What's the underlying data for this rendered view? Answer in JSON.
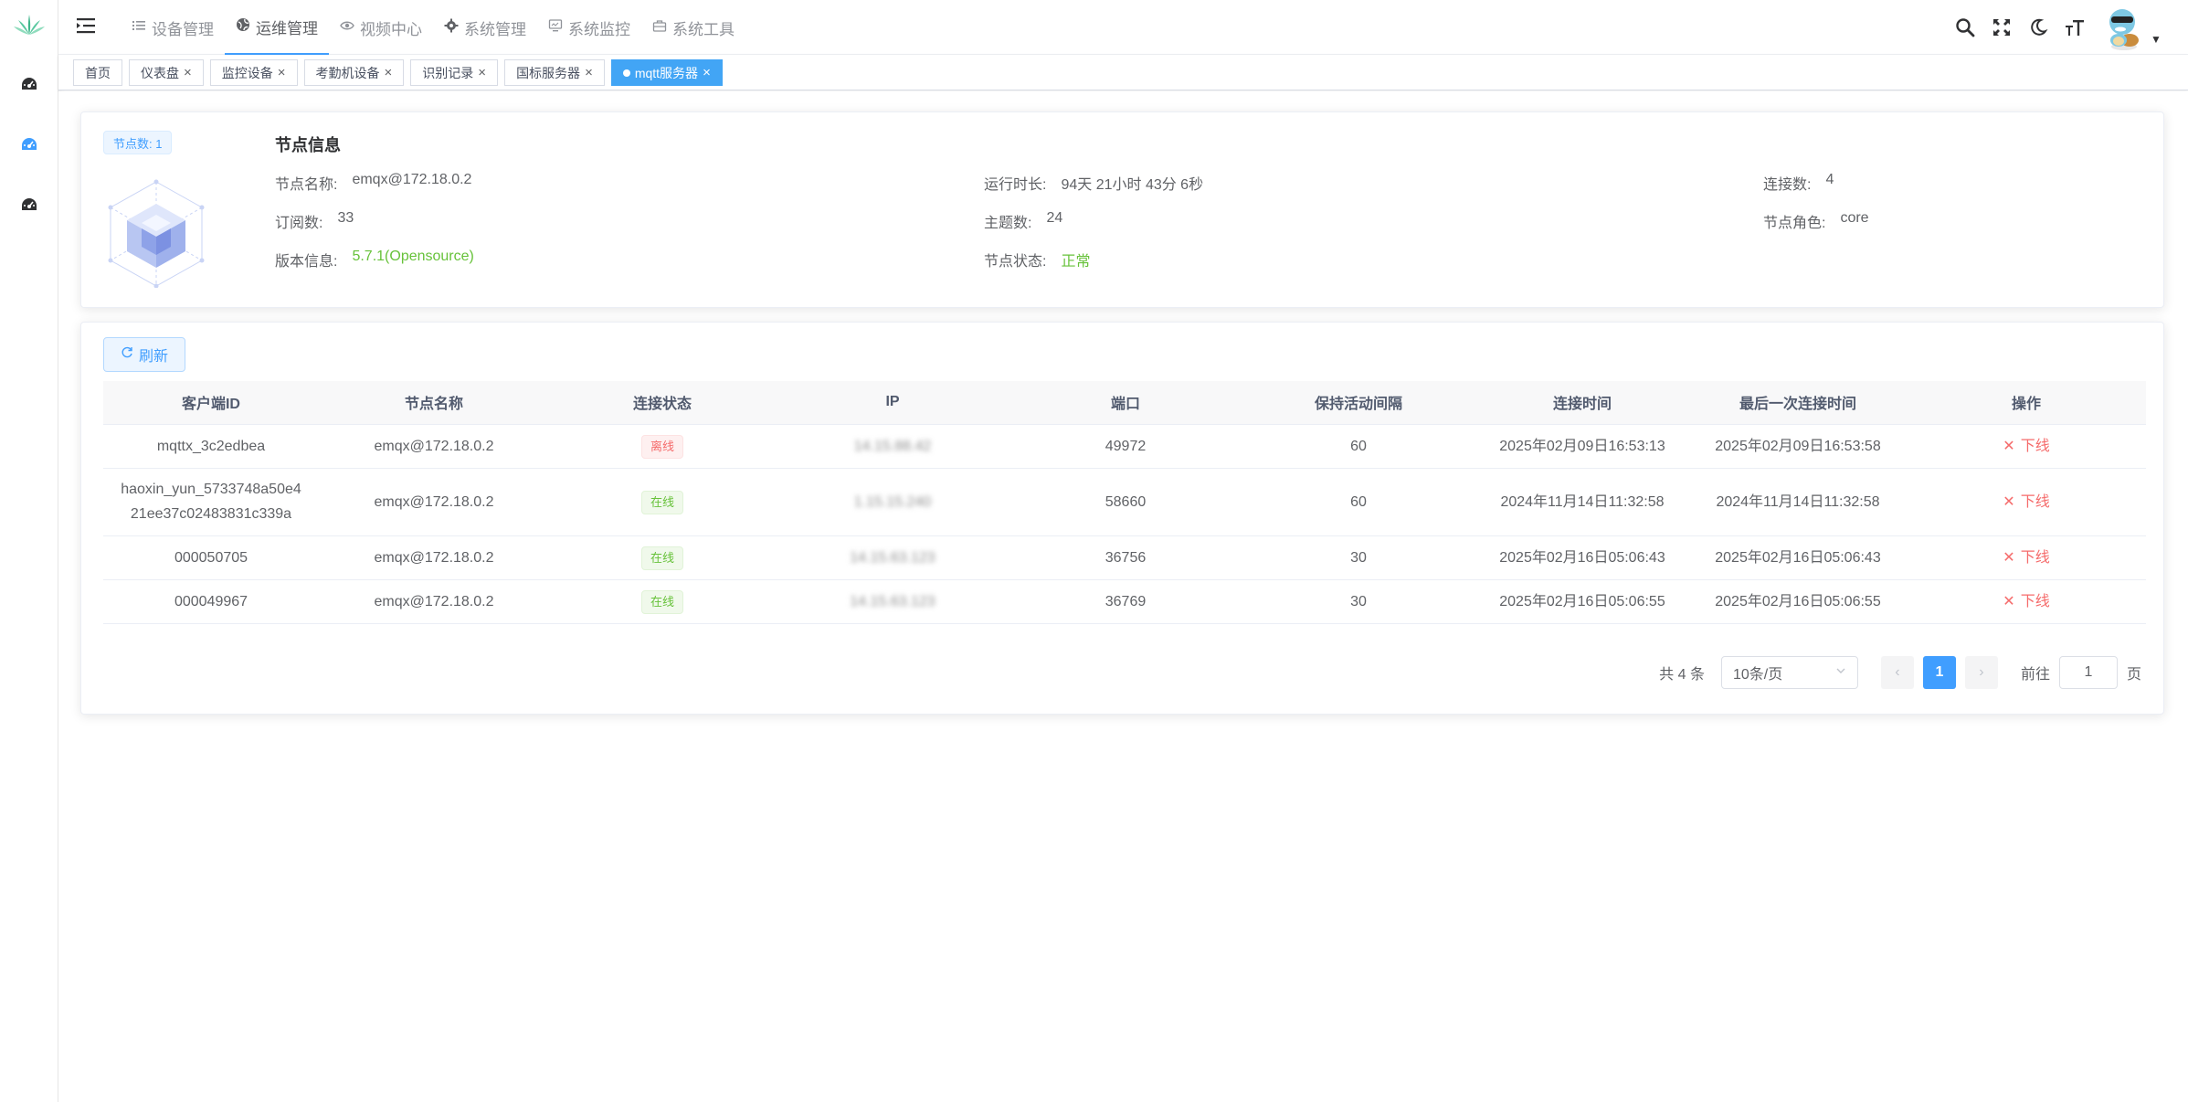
{
  "sidebar": {
    "logo": "lotus-logo",
    "items": [
      {
        "icon": "dashboard-icon"
      },
      {
        "icon": "dashboard-icon",
        "active": true
      },
      {
        "icon": "dashboard-icon"
      }
    ]
  },
  "navbar": {
    "menu": [
      {
        "label": "设备管理",
        "icon": "list-icon"
      },
      {
        "label": "运维管理",
        "icon": "globe-icon",
        "active": true
      },
      {
        "label": "视频中心",
        "icon": "eye-icon"
      },
      {
        "label": "系统管理",
        "icon": "gear-icon"
      },
      {
        "label": "系统监控",
        "icon": "monitor-icon"
      },
      {
        "label": "系统工具",
        "icon": "toolbox-icon"
      }
    ]
  },
  "tags": [
    {
      "label": "首页",
      "closable": false
    },
    {
      "label": "仪表盘",
      "closable": true
    },
    {
      "label": "监控设备",
      "closable": true
    },
    {
      "label": "考勤机设备",
      "closable": true
    },
    {
      "label": "识别记录",
      "closable": true
    },
    {
      "label": "国标服务器",
      "closable": true
    },
    {
      "label": "mqtt服务器",
      "closable": true,
      "active": true
    }
  ],
  "node_info": {
    "badge": "节点数: 1",
    "title": "节点信息",
    "name_label": "节点名称:",
    "name_value": "emqx@172.18.0.2",
    "uptime_label": "运行时长:",
    "uptime_value": "94天 21小时 43分 6秒",
    "conn_label": "连接数:",
    "conn_value": "4",
    "sub_label": "订阅数:",
    "sub_value": "33",
    "topic_label": "主题数:",
    "topic_value": "24",
    "role_label": "节点角色:",
    "role_value": "core",
    "version_label": "版本信息:",
    "version_value": "5.7.1(Opensource)",
    "status_label": "节点状态:",
    "status_value": "正常"
  },
  "table": {
    "refresh_label": "刷新",
    "headers": [
      "客户端ID",
      "节点名称",
      "连接状态",
      "IP",
      "端口",
      "保持活动间隔",
      "连接时间",
      "最后一次连接时间",
      "操作"
    ],
    "rows": [
      {
        "client_id": "mqttx_3c2edbea",
        "node": "emqx@172.18.0.2",
        "status": "离线",
        "status_type": "offline",
        "ip": "14.15.88.42",
        "port": "49972",
        "keepalive": "60",
        "connected_at": "2025年02月09日16:53:13",
        "last_connected_at": "2025年02月09日16:53:58",
        "action": "下线"
      },
      {
        "client_id": "haoxin_yun_5733748a50e4 21ee37c02483831c339a",
        "node": "emqx@172.18.0.2",
        "status": "在线",
        "status_type": "online",
        "ip": "1.15.15.240",
        "port": "58660",
        "keepalive": "60",
        "connected_at": "2024年11月14日11:32:58",
        "last_connected_at": "2024年11月14日11:32:58",
        "action": "下线"
      },
      {
        "client_id": "000050705",
        "node": "emqx@172.18.0.2",
        "status": "在线",
        "status_type": "online",
        "ip": "14.15.63.123",
        "port": "36756",
        "keepalive": "30",
        "connected_at": "2025年02月16日05:06:43",
        "last_connected_at": "2025年02月16日05:06:43",
        "action": "下线"
      },
      {
        "client_id": "000049967",
        "node": "emqx@172.18.0.2",
        "status": "在线",
        "status_type": "online",
        "ip": "14.15.63.123",
        "port": "36769",
        "keepalive": "30",
        "connected_at": "2025年02月16日05:06:55",
        "last_connected_at": "2025年02月16日05:06:55",
        "action": "下线"
      }
    ]
  },
  "pagination": {
    "total": "共 4 条",
    "page_size": "10条/页",
    "current_page": "1",
    "goto_label": "前往",
    "goto_value": "1",
    "page_suffix": "页"
  },
  "colors": {
    "primary": "#409eff",
    "success": "#67c23a",
    "danger": "#f56c6c",
    "tag_active": "#42a5f5"
  }
}
